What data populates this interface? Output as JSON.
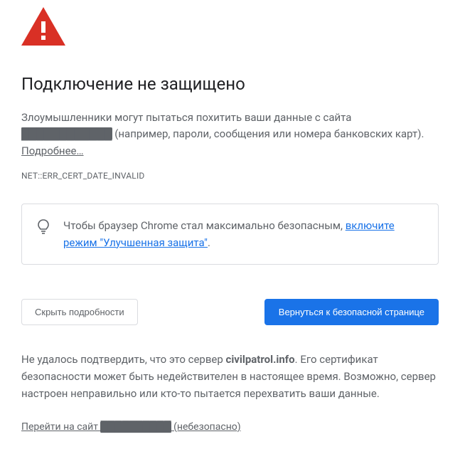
{
  "icon": "warning-triangle",
  "title": "Подключение не защищено",
  "description": {
    "prefix": "Злоумышленники могут пытаться похитить ваши данные с сайта ",
    "masked_site": "████████████",
    "suffix": " (например, пароли, сообщения или номера банковских карт). ",
    "learn_more": "Подробнее…"
  },
  "error_code": "NET::ERR_CERT_DATE_INVALID",
  "info_box": {
    "icon": "lightbulb",
    "text_prefix": "Чтобы браузер Chrome стал максимально безопасным, ",
    "link_text": "включите режим \"Улучшенная защита\"",
    "text_suffix": "."
  },
  "buttons": {
    "hide_details": "Скрыть подробности",
    "back_to_safety": "Вернуться к безопасной странице"
  },
  "details": {
    "prefix": "Не удалось подтвердить, что это сервер ",
    "server": "civilpatrol.info",
    "suffix": ". Его сертификат безопасности может быть недействителен в настоящее время. Возможно, сервер настроен неправильно или кто-то пытается перехватить ваши данные."
  },
  "proceed": {
    "prefix": "Перейти на сайт ",
    "masked_site": "██████████",
    "suffix": " (небезопасно)"
  }
}
